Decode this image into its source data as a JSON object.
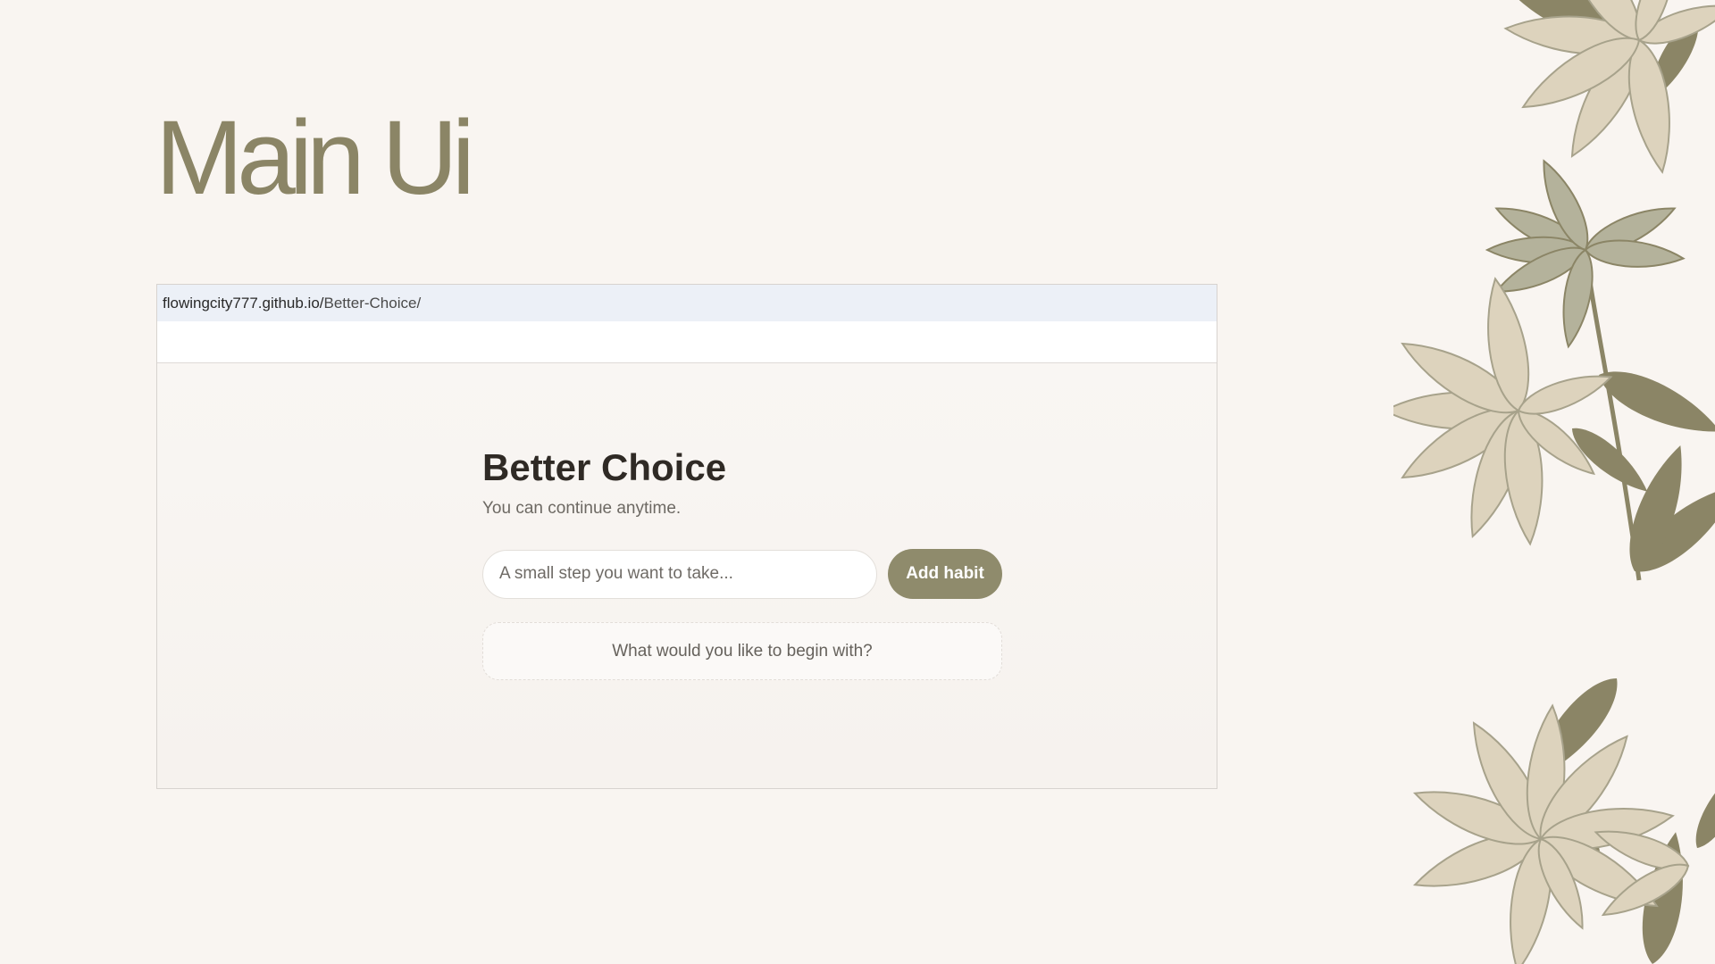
{
  "slide": {
    "title": "Main Ui"
  },
  "browser": {
    "url_host": "flowingcity777.github.io/",
    "url_path": "Better-Choice/"
  },
  "app": {
    "title": "Better Choice",
    "subtitle": "You can continue anytime.",
    "input_placeholder": "A small step you want to take...",
    "add_button_label": "Add habit",
    "empty_state_text": "What would you like to begin with?"
  },
  "colors": {
    "page_background": "#f9f5f1",
    "title_olive": "#8b8566",
    "accent_button": "#8f8b6c",
    "leaf_light": "#ddd3bd",
    "leaf_dark": "#8b8566",
    "leaf_grey": "#b4b29b"
  },
  "decorations": {
    "icon": "leaf-illustration"
  }
}
